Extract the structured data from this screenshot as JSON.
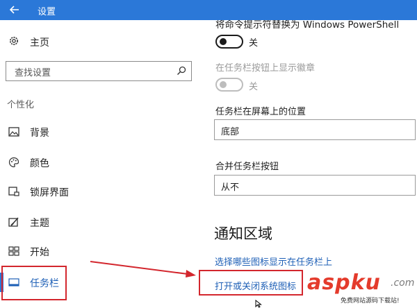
{
  "window": {
    "title": "设置",
    "accent_color": "#2b78d8",
    "back_icon": "back-arrow-icon"
  },
  "sidebar": {
    "home_label": "主页",
    "home_icon": "gear-icon",
    "search": {
      "placeholder": "查找设置",
      "icon": "search-icon"
    },
    "section_title": "个性化",
    "items": [
      {
        "label": "背景",
        "icon": "picture-icon",
        "active": false
      },
      {
        "label": "颜色",
        "icon": "palette-icon",
        "active": false
      },
      {
        "label": "锁屏界面",
        "icon": "lockscreen-icon",
        "active": false
      },
      {
        "label": "主题",
        "icon": "theme-icon",
        "active": false
      },
      {
        "label": "开始",
        "icon": "start-icon",
        "active": false
      },
      {
        "label": "任务栏",
        "icon": "taskbar-icon",
        "active": true
      }
    ]
  },
  "main": {
    "powershell_label": "将命令提示符替换为 Windows PowerShell",
    "powershell_toggle_state": "关",
    "badges_label": "在任务栏按钮上显示徽章",
    "badges_toggle_state": "关",
    "position_label": "任务栏在屏幕上的位置",
    "position_value": "底部",
    "combine_label": "合并任务栏按钮",
    "combine_value": "从不",
    "notification_heading": "通知区域",
    "link_select_icons": "选择哪些图标显示在任务栏上",
    "link_system_icons": "打开或关闭系统图标"
  },
  "annotations": {
    "highlight_color": "#d3262d"
  },
  "watermark": {
    "logo": "aspku",
    "dotcom": ".com",
    "subtitle": "免费网站源码下载站!"
  }
}
